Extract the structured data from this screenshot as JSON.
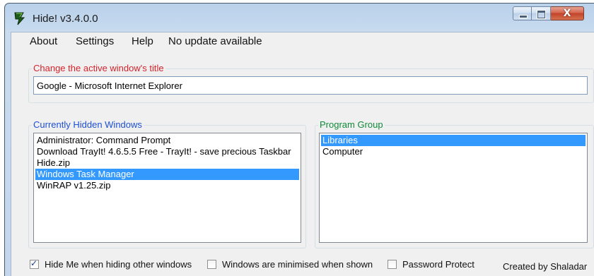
{
  "window": {
    "title": "Hide! v3.4.0.0",
    "icon": "app-leaf-icon",
    "controls": {
      "minimize": "minimize",
      "maximize": "maximize",
      "close": "X"
    }
  },
  "menu": {
    "items": [
      "About",
      "Settings",
      "Help",
      "No update available"
    ]
  },
  "rename_group": {
    "legend": "Change the active window's title",
    "value": "Google - Microsoft Internet Explorer"
  },
  "hidden_group": {
    "legend": "Currently Hidden Windows",
    "items": [
      "Administrator: Command Prompt",
      "Download TrayIt! 4.6.5.5 Free - TrayIt! - save precious Taskbar",
      "Hide.zip",
      "Windows Task Manager",
      "WinRAP v1.25.zip"
    ],
    "selected_index": 3
  },
  "program_group": {
    "legend": "Program Group",
    "items": [
      "Libraries",
      "Computer"
    ],
    "selected_index": 0
  },
  "options": {
    "hide_me": {
      "label": "Hide Me when hiding other windows",
      "checked": true
    },
    "minimised": {
      "label": "Windows are minimised when shown",
      "checked": false
    },
    "password": {
      "label": "Password Protect",
      "checked": false
    }
  },
  "credit": "Created by Shaladar",
  "colors": {
    "legend_rename": "#d4232b",
    "legend_hidden": "#1e4fd6",
    "legend_program": "#0f8a3a",
    "selection": "#3399ff"
  }
}
